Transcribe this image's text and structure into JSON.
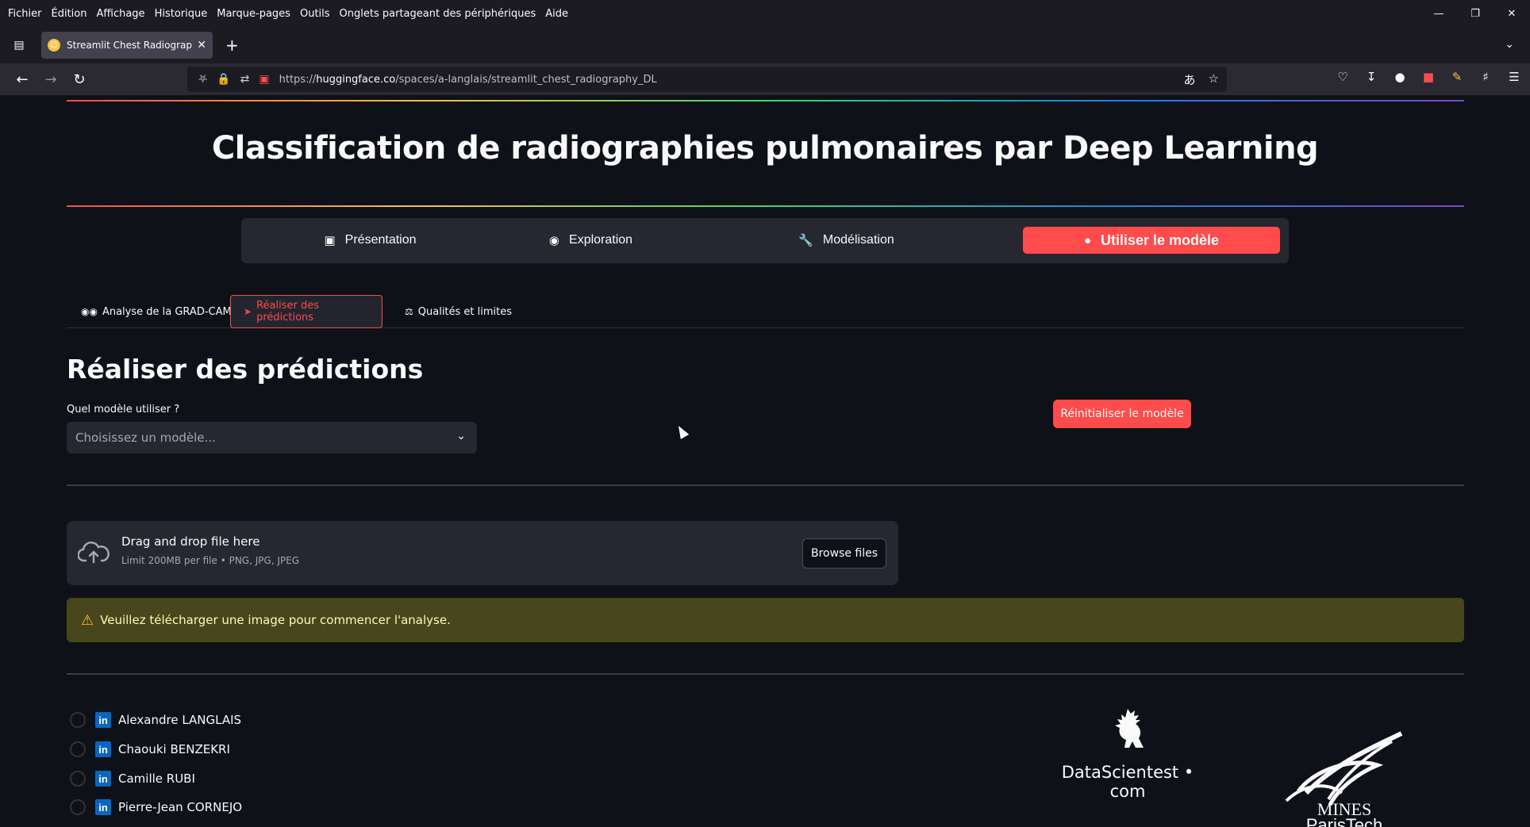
{
  "browser": {
    "menu": [
      "Fichier",
      "Édition",
      "Affichage",
      "Historique",
      "Marque-pages",
      "Outils",
      "Onglets partageant des périphériques",
      "Aide"
    ],
    "tab_title": "Streamlit Chest Radiography DL",
    "url_prefix": "https://",
    "url_host": "huggingface.co",
    "url_path": "/spaces/a-langlais/streamlit_chest_radiography_DL"
  },
  "page": {
    "title": "Classification de radiographies pulmonaires par Deep Learning",
    "nav": [
      {
        "label": "Présentation",
        "icon": "presentation-icon"
      },
      {
        "label": "Exploration",
        "icon": "eye-icon"
      },
      {
        "label": "Modélisation",
        "icon": "wrench-icon"
      },
      {
        "label": "Utiliser le modèle",
        "icon": "lightbulb-icon",
        "active": true
      }
    ],
    "subtabs": [
      {
        "label": "Analyse de la GRAD-CAM",
        "icon": "glasses-icon"
      },
      {
        "label": "Réaliser des prédictions",
        "icon": "rocket-icon",
        "active": true
      },
      {
        "label": "Qualités et limites",
        "icon": "scale-icon"
      }
    ],
    "section_title": "Réaliser des prédictions",
    "model_label": "Quel modèle utiliser ?",
    "model_placeholder": "Choisissez un modèle...",
    "reset_button": "Réinitialiser le modèle",
    "uploader": {
      "title": "Drag and drop file here",
      "limit": "Limit 200MB per file • PNG, JPG, JPEG",
      "browse": "Browse files"
    },
    "warning": "Veuillez télécharger une image pour commencer l'analyse.",
    "contributors": [
      "Alexandre LANGLAIS",
      "Chaouki BENZEKRI",
      "Camille RUBI",
      "Pierre-Jean CORNEJO"
    ],
    "logos": {
      "datascientest": "DataScientest • com",
      "mines_line1": "MINES",
      "mines_line2": "ParisTech"
    },
    "colors": {
      "accent": "#ff4b4b",
      "background": "#0e1117",
      "warning_bg": "#47461c"
    }
  }
}
